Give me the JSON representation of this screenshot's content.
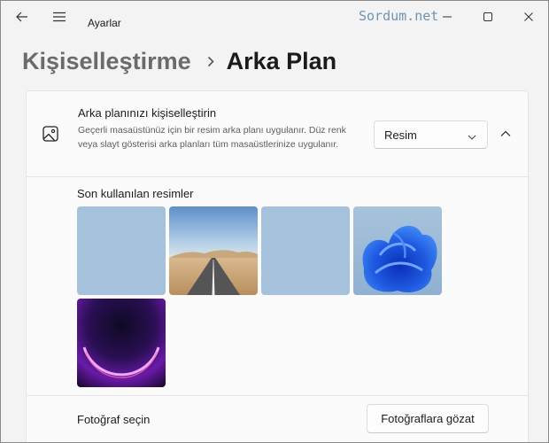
{
  "titlebar": {
    "app_title": "Ayarlar",
    "watermark": "Sordum.net",
    "icons": [
      "back-arrow-icon",
      "hamburger-menu-icon",
      "minimize-icon",
      "maximize-icon",
      "close-icon"
    ]
  },
  "breadcrumb": {
    "parent": "Kişiselleştirme",
    "current": "Arka Plan",
    "separator_icon": "chevron-right-icon"
  },
  "background_card": {
    "icon": "image-icon",
    "title": "Arka planınızı kişiselleştirin",
    "description": "Geçerli masaüstünüz için bir resim arka planı uygulanır. Düz renk veya slayt gösterisi arka planları tüm masaüstlerinize uygulanır.",
    "dropdown": {
      "selected": "Resim"
    },
    "expanded": true
  },
  "recent_images": {
    "label": "Son kullanılan resimler",
    "items": [
      {
        "kind": "solid-blue"
      },
      {
        "kind": "desert-road"
      },
      {
        "kind": "solid-blue"
      },
      {
        "kind": "windows-11-bloom"
      },
      {
        "kind": "purple-glow"
      }
    ]
  },
  "choose_photo": {
    "label": "Fotoğraf seçin",
    "button": "Fotoğraflara gözat"
  },
  "colors": {
    "window_bg": "#f3f3f3",
    "card_bg": "#fbfbfb",
    "watermark": "#6f93b5",
    "solid_thumb": "#a6c1dc"
  }
}
